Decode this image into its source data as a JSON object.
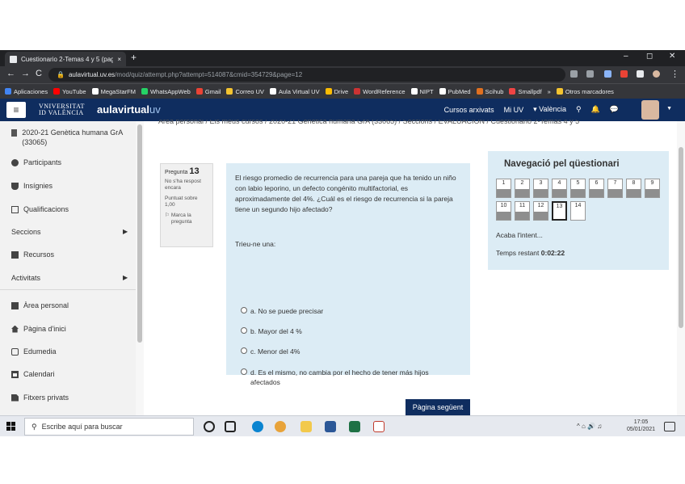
{
  "browser": {
    "tab_title": "Cuestionario 2-Temas 4 y 5 (pag",
    "tab_close": "×",
    "new_tab": "+",
    "url_host": "aulavirtual.uv.es",
    "url_path": "/mod/quiz/attempt.php?attempt=514087&cmid=354729&page=12",
    "controls": {
      "minimize": "–",
      "maximize": "◻",
      "close": "✕"
    },
    "nav": {
      "back": "←",
      "forward": "→",
      "reload": "C"
    }
  },
  "bookmarks": [
    {
      "label": "Aplicaciones",
      "color": "#4285f4"
    },
    {
      "label": "YouTube",
      "color": "#ff0000"
    },
    {
      "label": "MegaStarFM",
      "color": "#ffffff"
    },
    {
      "label": "WhatsAppWeb",
      "color": "#25d366"
    },
    {
      "label": "Gmail",
      "color": "#ea4335"
    },
    {
      "label": "Correo UV",
      "color": "#f4c430"
    },
    {
      "label": "Aula Virtual UV",
      "color": "#ffffff"
    },
    {
      "label": "Drive",
      "color": "#fbbc04"
    },
    {
      "label": "WordReference",
      "color": "#cc3333"
    },
    {
      "label": "NIPT",
      "color": "#ffffff"
    },
    {
      "label": "PubMed",
      "color": "#ffffff"
    },
    {
      "label": "Scihub",
      "color": "#e07020"
    },
    {
      "label": "Smallpdf",
      "color": "#ee4444"
    },
    {
      "label": "»",
      "color": ""
    },
    {
      "label": "Otros marcadores",
      "color": "#f4c430"
    }
  ],
  "navbar": {
    "uv_logo_line1": "VNIVERSITAT",
    "uv_logo_line2": "ID VALÈNCIA",
    "brand_a": "aula",
    "brand_b": "virtual",
    "brand_c": "uv",
    "archived_courses": "Cursos arxivats",
    "my_uv": "Mi UV",
    "language": "▾ València"
  },
  "breadcrumb": "Àrea personal / Els meus cursos / 2020-21 Genètica humana GrA (33065) / Seccions / EVALUACIÓN / Cuestionario 2-Temas 4 y 5",
  "sidebar": {
    "course": "2020-21 Genètica humana GrA (33065)",
    "participants": "Participants",
    "badges": "Insígnies",
    "grades": "Qualificacions",
    "sections": "Seccions",
    "resources": "Recursos",
    "activities": "Activitats",
    "dashboard": "Àrea personal",
    "home": "Pàgina d'inici",
    "edumedia": "Edumedia",
    "calendar": "Calendari",
    "private_files": "Fitxers privats"
  },
  "question": {
    "label": "Pregunta",
    "number": "13",
    "status": "No s'ha respost encara",
    "points": "Puntuat sobre 1,00",
    "flag": "Marca la pregunta",
    "text": "El riesgo promedio de recurrencia para una pareja que ha tenido un niño con labio leporino, un defecto congénito multifactorial, es aproximadamente del 4%. ¿Cuál es el riesgo de recurrencia si la pareja tiene un segundo hijo afectado?",
    "prompt": "Trieu-ne una:",
    "answers": [
      "a. No se puede precisar",
      "b. Mayor del 4 %",
      "c. Menor del 4%",
      "d. Es el mismo, no cambia por el hecho de tener más hijos afectados"
    ],
    "next_button": "Pàgina següent"
  },
  "quiz_nav": {
    "title": "Navegació pel qüestionari",
    "buttons": [
      "1",
      "2",
      "3",
      "4",
      "5",
      "6",
      "7",
      "8",
      "9",
      "10",
      "11",
      "12",
      "13",
      "14"
    ],
    "finish": "Acaba l'intent...",
    "time_label": "Temps restant",
    "time_value": "0:02:22"
  },
  "taskbar": {
    "search_placeholder": "Escribe aquí para buscar",
    "tray": "^ ⌂ 🔊 ♫ ",
    "time": "17:05",
    "date": "05/01/2021"
  }
}
